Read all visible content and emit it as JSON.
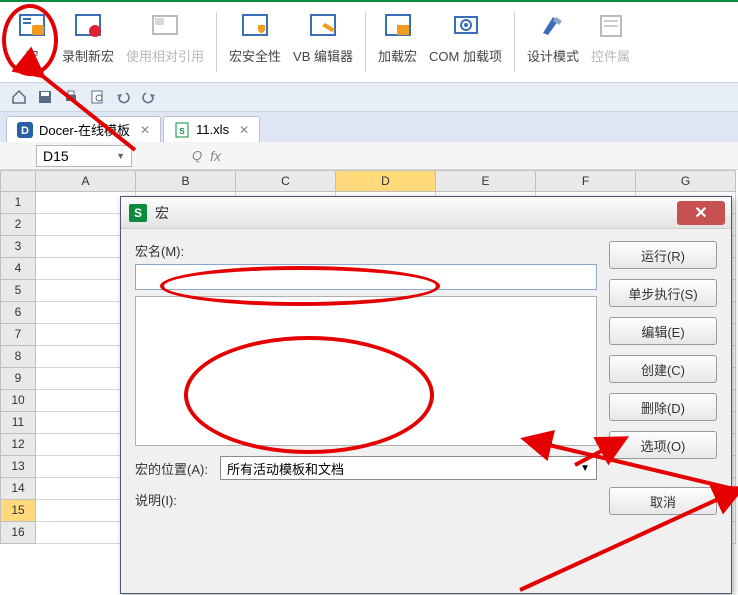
{
  "ribbon": {
    "items": [
      {
        "label": "宏",
        "icon": "macro"
      },
      {
        "label": "录制新宏",
        "icon": "record"
      },
      {
        "label": "使用相对引用",
        "icon": "relative",
        "disabled": true
      },
      {
        "label": "宏安全性",
        "icon": "security"
      },
      {
        "label": "VB 编辑器",
        "icon": "vbe"
      },
      {
        "label": "加载宏",
        "icon": "addin"
      },
      {
        "label": "COM 加载项",
        "icon": "com"
      },
      {
        "label": "设计模式",
        "icon": "design"
      },
      {
        "label": "控件属",
        "icon": "props",
        "disabled": true
      }
    ]
  },
  "tabs": [
    {
      "label": "Docer-在线模板",
      "icon": "docer"
    },
    {
      "label": "11.xls",
      "icon": "xls"
    }
  ],
  "namebox": "D15",
  "colheaders": [
    "A",
    "B",
    "C",
    "D",
    "E",
    "F",
    "G"
  ],
  "rowheaders": [
    "1",
    "2",
    "3",
    "4",
    "5",
    "6",
    "7",
    "8",
    "9",
    "10",
    "11",
    "12",
    "13",
    "14",
    "15",
    "16"
  ],
  "selectedRow": "15",
  "selectedCol": "D",
  "dialog": {
    "title": "宏",
    "macroNameLabel": "宏名(M):",
    "macroName": "",
    "locationLabel": "宏的位置(A):",
    "locationValue": "所有活动模板和文档",
    "descLabel": "说明(I):",
    "buttons": {
      "run": "运行(R)",
      "step": "单步执行(S)",
      "edit": "编辑(E)",
      "create": "创建(C)",
      "delete": "删除(D)",
      "options": "选项(O)",
      "cancel": "取消"
    }
  }
}
